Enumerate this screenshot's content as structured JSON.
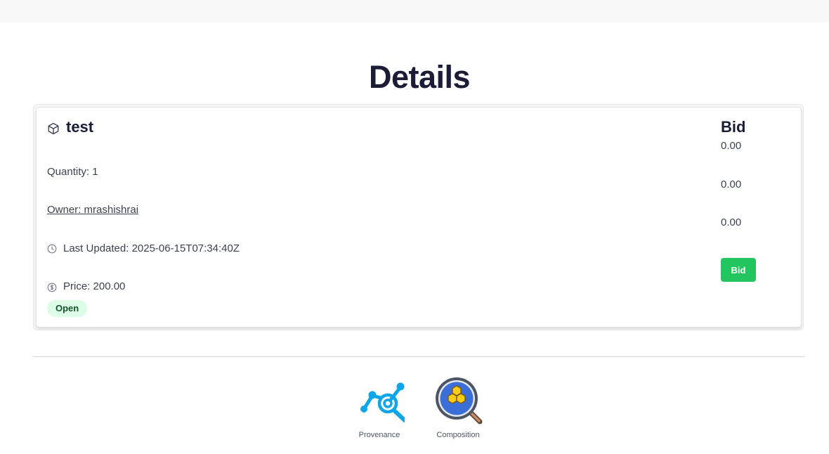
{
  "page": {
    "title": "Details"
  },
  "item": {
    "name": "test",
    "quantity": "Quantity: 1",
    "owner": "Owner: mrashishrai",
    "last_updated": "Last Updated: 2025-06-15T07:34:40Z",
    "price": "Price: 200.00",
    "status": "Open",
    "status_color": "#dcfce7"
  },
  "bid_panel": {
    "heading": "Bid",
    "values": [
      "0.00",
      "0.00",
      "0.00"
    ],
    "button_label": "Bid",
    "button_color": "#22c55e"
  },
  "tools": [
    {
      "label": "Provenance",
      "icon": "provenance-icon"
    },
    {
      "label": "Composition",
      "icon": "composition-icon"
    }
  ]
}
